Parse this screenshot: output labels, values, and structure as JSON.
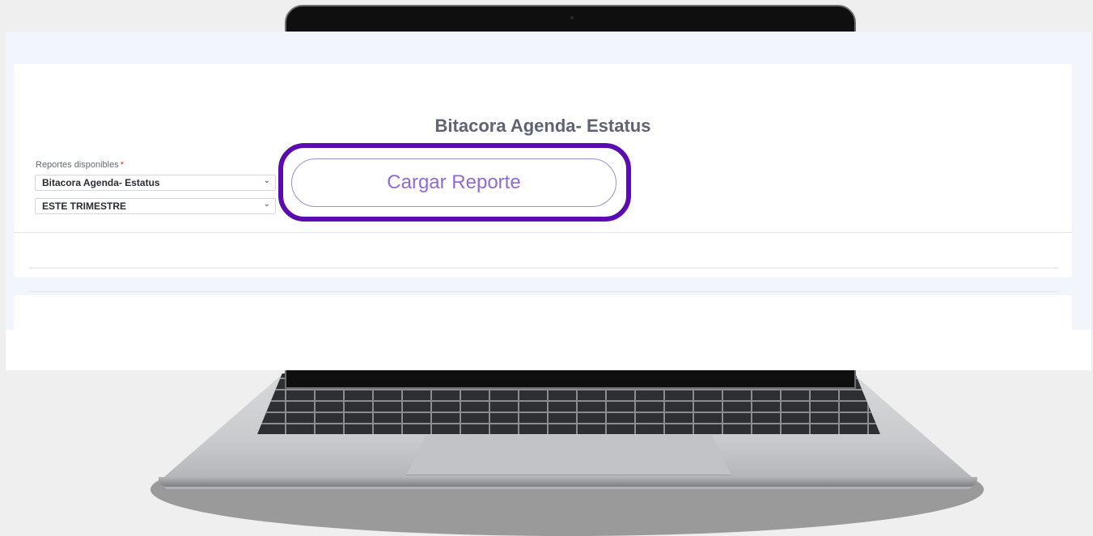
{
  "report": {
    "title": "Bitacora Agenda- Estatus",
    "field_label": "Reportes disponibles",
    "required_mark": "*",
    "selected_report": "Bitacora Agenda- Estatus",
    "selected_period": "ESTE TRIMESTRE",
    "load_button_label": "Cargar Reporte"
  },
  "icons": {
    "report_chevron": "chevron-down-icon",
    "period_chevron": "chevron-down-icon"
  },
  "colors": {
    "highlight": "#5a0cb0",
    "button_text": "#8f6ad8",
    "title_text": "#5f6373",
    "required": "#e0333a"
  }
}
